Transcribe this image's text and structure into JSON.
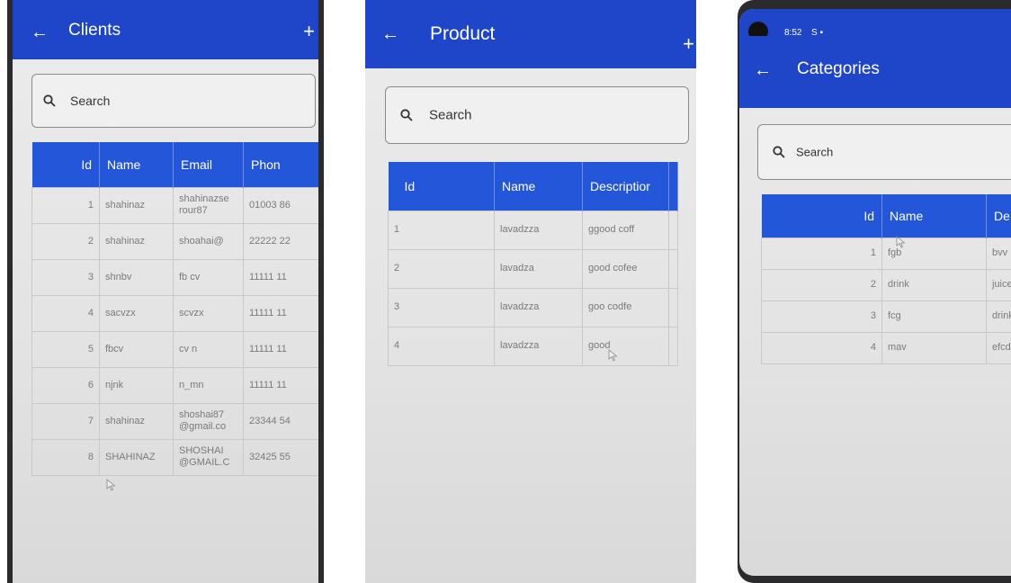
{
  "clients": {
    "title": "Clients",
    "back_icon": "arrow-left-icon",
    "add_icon": "plus-icon",
    "search_placeholder": "Search",
    "columns": [
      "Id",
      "Name",
      "Email",
      "Phon"
    ],
    "rows": [
      {
        "id": "1",
        "name": "shahinaz",
        "email": "shahinazse rour87",
        "phone": "01003 86"
      },
      {
        "id": "2",
        "name": "shahinaz",
        "email": "shoahai@",
        "phone": "22222 22"
      },
      {
        "id": "3",
        "name": "shnbv",
        "email": "fb cv",
        "phone": "11111 11"
      },
      {
        "id": "4",
        "name": "sacvzx",
        "email": "scvzx",
        "phone": "11111 11"
      },
      {
        "id": "5",
        "name": "fbcv",
        "email": "cv n",
        "phone": "11111 11"
      },
      {
        "id": "6",
        "name": "njnk",
        "email": "n_mn",
        "phone": "11111 11"
      },
      {
        "id": "7",
        "name": "shahinaz",
        "email": "shoshai87 @gmail.co",
        "phone": "23344 54"
      },
      {
        "id": "8",
        "name": "SHAHINAZ",
        "email": "SHOSHAI @GMAIL.C",
        "phone": "32425 55"
      }
    ]
  },
  "product": {
    "title": "Product",
    "back_icon": "arrow-left-icon",
    "add_icon": "plus-icon",
    "search_placeholder": "Search",
    "columns": [
      "Id",
      "Name",
      "Descriptior"
    ],
    "rows": [
      {
        "id": "1",
        "name": "lavadzza",
        "description": "ggood coff"
      },
      {
        "id": "2",
        "name": "lavadza",
        "description": "good cofee"
      },
      {
        "id": "3",
        "name": "lavadzza",
        "description": "goo codfe"
      },
      {
        "id": "4",
        "name": "lavadzza",
        "description": "good"
      }
    ]
  },
  "categories": {
    "status_time": "8:52",
    "status_icons": "S ▪",
    "title": "Categories",
    "back_icon": "arrow-left-icon",
    "search_placeholder": "Search",
    "columns": [
      "Id",
      "Name",
      "De"
    ],
    "rows": [
      {
        "id": "1",
        "name": "fgb",
        "desc": "bvv"
      },
      {
        "id": "2",
        "name": "drink",
        "desc": "juice"
      },
      {
        "id": "3",
        "name": "fcg",
        "desc": "drink"
      },
      {
        "id": "4",
        "name": "mav",
        "desc": "efcd"
      }
    ]
  },
  "colors": {
    "appbar": "#1f45c9",
    "table_header": "#2356d8"
  }
}
